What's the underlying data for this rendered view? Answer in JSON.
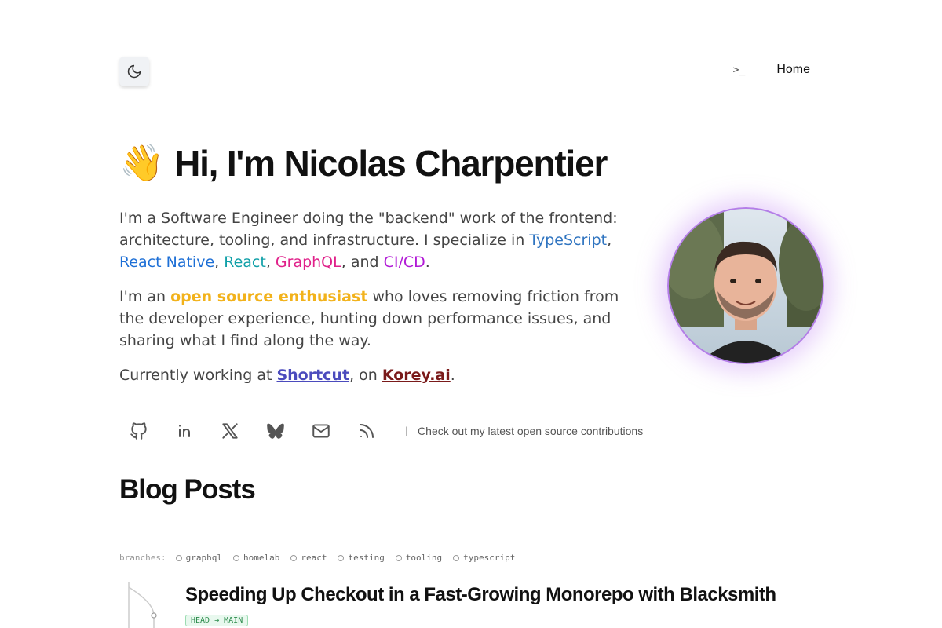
{
  "header": {
    "theme_icon": "moon-icon",
    "nav": {
      "terminal_label": ">_",
      "home_label": "Home"
    }
  },
  "hero": {
    "emoji": "👋",
    "title": "Hi, I'm Nicolas Charpentier",
    "p1": {
      "text_a": "I'm a Software Engineer doing the \"backend\" work of the frontend: architecture, tooling, and infrastructure. I specialize in ",
      "typescript": "TypeScript",
      "sep1": ", ",
      "react_native": "React Native",
      "sep2": ", ",
      "react": "React",
      "sep3": ", ",
      "graphql": "GraphQL",
      "sep4": ", and ",
      "cicd": "CI/CD",
      "end": "."
    },
    "p2": {
      "text_a": "I'm an ",
      "oss": "open source enthusiast",
      "text_b": " who loves removing friction from the developer experience, hunting down performance issues, and sharing what I find along the way."
    },
    "p3": {
      "text_a": "Currently working at ",
      "shortcut": "Shortcut",
      "text_b": ", on ",
      "korey": "Korey.ai",
      "end": "."
    }
  },
  "socials": {
    "icons": [
      "github-icon",
      "linkedin-icon",
      "x-icon",
      "bluesky-icon",
      "mail-icon",
      "rss-icon"
    ],
    "separator": "|",
    "caption": "Check out my latest open source contributions"
  },
  "blog": {
    "title": "Blog Posts",
    "branches_label": "branches:",
    "branches": [
      "graphql",
      "homelab",
      "react",
      "testing",
      "tooling",
      "typescript"
    ],
    "posts": [
      {
        "title": "Speeding Up Checkout in a Fast-Growing Monorepo with Blacksmith",
        "badge": "HEAD → MAIN"
      }
    ]
  }
}
